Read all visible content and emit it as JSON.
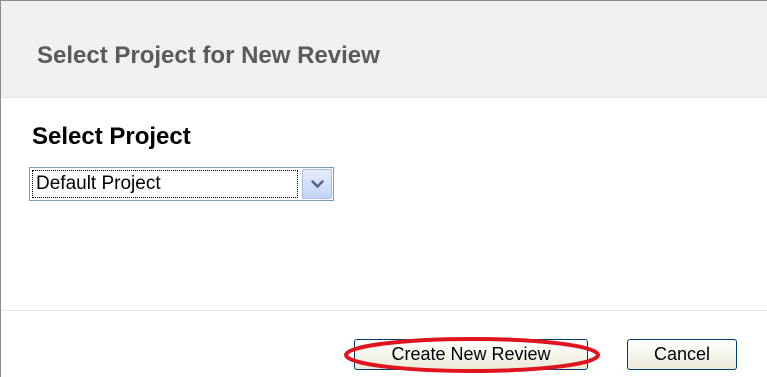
{
  "dialog": {
    "title": "Select Project for New Review"
  },
  "project_select": {
    "label": "Select Project",
    "selected_value": "Default Project",
    "arrow_icon": "chevron-down-icon"
  },
  "footer": {
    "create_label": "Create New Review",
    "cancel_label": "Cancel"
  },
  "colors": {
    "annotation_ring": "#e0141e",
    "header_background": "#f0f0f0",
    "title_text": "#5a5a5a"
  }
}
